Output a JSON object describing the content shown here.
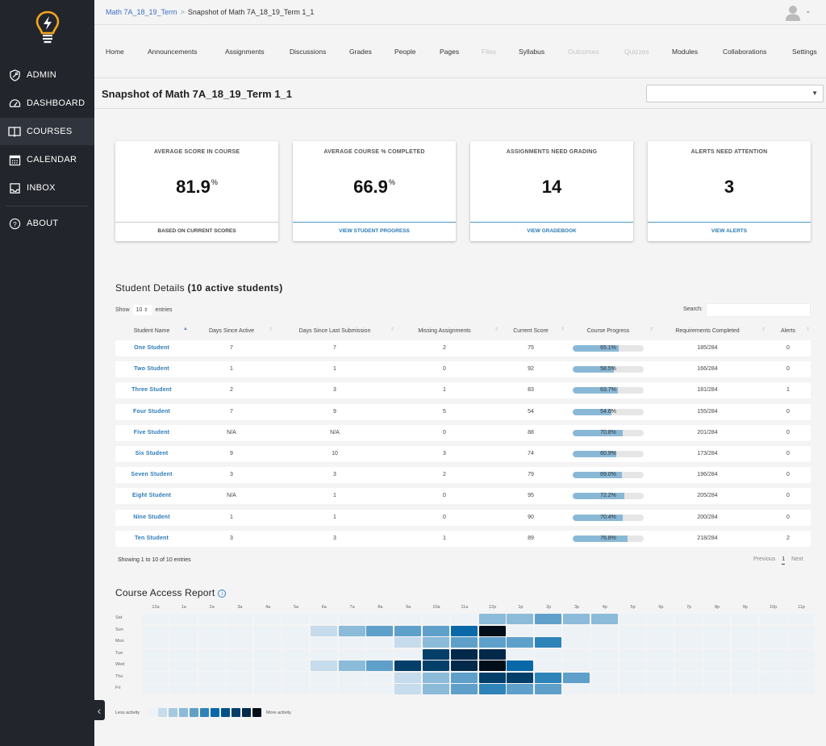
{
  "sidebar": {
    "logo": "lightbulb-logo",
    "items": [
      {
        "label": "ADMIN",
        "icon": "shield-wrench-icon",
        "active": false
      },
      {
        "label": "DASHBOARD",
        "icon": "speedometer-icon",
        "active": false
      },
      {
        "label": "COURSES",
        "icon": "book-icon",
        "active": true
      },
      {
        "label": "CALENDAR",
        "icon": "calendar-icon",
        "active": false
      },
      {
        "label": "INBOX",
        "icon": "inbox-icon",
        "active": false
      },
      {
        "label": "ABOUT",
        "icon": "question-circle-icon",
        "active": false
      }
    ],
    "collapse_icon": "chevron-left-icon"
  },
  "header": {
    "breadcrumb": {
      "parent": "Math 7A_18_19_Term",
      "separator": ">",
      "current": "Snapshot of Math 7A_18_19_Term 1_1"
    },
    "user_menu_icon": "chevron-down-icon"
  },
  "course_nav": [
    {
      "label": "Home",
      "enabled": true
    },
    {
      "label": "Announcements",
      "enabled": true
    },
    {
      "label": "Assignments",
      "enabled": true
    },
    {
      "label": "Discussions",
      "enabled": true
    },
    {
      "label": "Grades",
      "enabled": true
    },
    {
      "label": "People",
      "enabled": true
    },
    {
      "label": "Pages",
      "enabled": true
    },
    {
      "label": "Files",
      "enabled": false
    },
    {
      "label": "Syllabus",
      "enabled": true
    },
    {
      "label": "Outcomes",
      "enabled": false
    },
    {
      "label": "Quizzes",
      "enabled": false
    },
    {
      "label": "Modules",
      "enabled": true
    },
    {
      "label": "Collaborations",
      "enabled": true
    },
    {
      "label": "Settings",
      "enabled": true
    }
  ],
  "page": {
    "title": "Snapshot of Math 7A_18_19_Term 1_1",
    "section_select_value": ""
  },
  "cards": [
    {
      "title": "AVERAGE SCORE IN COURSE",
      "value": "81.9",
      "unit": "%",
      "footer": "BASED ON CURRENT SCORES",
      "footer_link": false
    },
    {
      "title": "AVERAGE COURSE % COMPLETED",
      "value": "66.9",
      "unit": "%",
      "footer": "VIEW STUDENT PROGRESS",
      "footer_link": true
    },
    {
      "title": "ASSIGNMENTS NEED GRADING",
      "value": "14",
      "unit": "",
      "footer": "VIEW GRADEBOOK",
      "footer_link": true
    },
    {
      "title": "ALERTS NEED ATTENTION",
      "value": "3",
      "unit": "",
      "footer": "VIEW ALERTS",
      "footer_link": true
    }
  ],
  "student_details": {
    "title": "Student Details",
    "count_label": "(10 active students)",
    "show_label": "Show",
    "entries_value": "10",
    "entries_label": "entries",
    "search_label": "Search:",
    "search_value": "",
    "columns": [
      "Student Name",
      "Days Since Active",
      "Days Since Last Submission",
      "Missing Assignments",
      "Current Score",
      "Course Progress",
      "Requirements Completed",
      "Alerts"
    ],
    "rows": [
      {
        "name": "One Student",
        "days_active": "7",
        "days_submission": "7",
        "missing": "2",
        "score": "75",
        "progress": 65.1,
        "progress_label": "65.1%",
        "requirements": "185/284",
        "alerts": "0"
      },
      {
        "name": "Two Student",
        "days_active": "1",
        "days_submission": "1",
        "missing": "0",
        "score": "92",
        "progress": 58.5,
        "progress_label": "58.5%",
        "requirements": "166/284",
        "alerts": "0"
      },
      {
        "name": "Three Student",
        "days_active": "2",
        "days_submission": "3",
        "missing": "1",
        "score": "83",
        "progress": 63.7,
        "progress_label": "63.7%",
        "requirements": "181/284",
        "alerts": "1"
      },
      {
        "name": "Four Student",
        "days_active": "7",
        "days_submission": "9",
        "missing": "5",
        "score": "54",
        "progress": 54.6,
        "progress_label": "54.6%",
        "requirements": "155/284",
        "alerts": "0"
      },
      {
        "name": "Five Student",
        "days_active": "N/A",
        "days_submission": "N/A",
        "missing": "0",
        "score": "88",
        "progress": 70.8,
        "progress_label": "70.8%",
        "requirements": "201/284",
        "alerts": "0"
      },
      {
        "name": "Six Student",
        "days_active": "9",
        "days_submission": "10",
        "missing": "3",
        "score": "74",
        "progress": 60.9,
        "progress_label": "60.9%",
        "requirements": "173/284",
        "alerts": "0"
      },
      {
        "name": "Seven Student",
        "days_active": "3",
        "days_submission": "3",
        "missing": "2",
        "score": "79",
        "progress": 69.0,
        "progress_label": "69.0%",
        "requirements": "196/284",
        "alerts": "0"
      },
      {
        "name": "Eight Student",
        "days_active": "N/A",
        "days_submission": "1",
        "missing": "0",
        "score": "95",
        "progress": 72.2,
        "progress_label": "72.2%",
        "requirements": "205/284",
        "alerts": "0"
      },
      {
        "name": "Nine Student",
        "days_active": "1",
        "days_submission": "1",
        "missing": "0",
        "score": "90",
        "progress": 70.4,
        "progress_label": "70.4%",
        "requirements": "200/284",
        "alerts": "0"
      },
      {
        "name": "Ten Student",
        "days_active": "3",
        "days_submission": "3",
        "missing": "1",
        "score": "89",
        "progress": 76.8,
        "progress_label": "76.8%",
        "requirements": "218/284",
        "alerts": "2"
      }
    ],
    "showing_text": "Showing 1 to 10 of 10 entries",
    "pager": {
      "previous": "Previous",
      "current": "1",
      "next": "Next"
    }
  },
  "access_report": {
    "title": "Course Access Report",
    "info_icon": "info-circle-icon",
    "hours": [
      "12a",
      "1a",
      "2a",
      "3a",
      "4a",
      "5a",
      "6a",
      "7a",
      "8a",
      "9a",
      "10a",
      "11a",
      "12p",
      "1p",
      "2p",
      "3p",
      "4p",
      "5p",
      "6p",
      "7p",
      "8p",
      "9p",
      "10p",
      "11p"
    ],
    "days": [
      "Sat",
      "Sun",
      "Mon",
      "Tue",
      "Wed",
      "Thu",
      "Fri"
    ],
    "levels": [
      [
        0,
        0,
        0,
        0,
        0,
        0,
        0,
        0,
        0,
        0,
        0,
        0,
        3,
        3,
        4,
        3,
        3,
        0,
        0,
        0,
        0,
        0,
        0,
        0
      ],
      [
        0,
        0,
        0,
        0,
        0,
        0,
        1,
        3,
        4,
        4,
        4,
        6,
        10,
        0,
        0,
        0,
        0,
        0,
        0,
        0,
        0,
        0,
        0,
        0
      ],
      [
        0,
        0,
        0,
        0,
        0,
        0,
        0,
        0,
        0,
        1,
        3,
        4,
        4,
        4,
        5,
        0,
        0,
        0,
        0,
        0,
        0,
        0,
        0,
        0
      ],
      [
        0,
        0,
        0,
        0,
        0,
        0,
        0,
        0,
        0,
        0,
        8,
        9,
        9,
        0,
        0,
        0,
        0,
        0,
        0,
        0,
        0,
        0,
        0,
        0
      ],
      [
        0,
        0,
        0,
        0,
        0,
        0,
        1,
        3,
        4,
        8,
        8,
        9,
        10,
        6,
        0,
        0,
        0,
        0,
        0,
        0,
        0,
        0,
        0,
        0
      ],
      [
        0,
        0,
        0,
        0,
        0,
        0,
        0,
        0,
        0,
        1,
        3,
        4,
        8,
        8,
        5,
        4,
        0,
        0,
        0,
        0,
        0,
        0,
        0,
        0
      ],
      [
        0,
        0,
        0,
        0,
        0,
        0,
        0,
        0,
        0,
        1,
        3,
        4,
        5,
        4,
        4,
        0,
        0,
        0,
        0,
        0,
        0,
        0,
        0,
        0
      ]
    ],
    "palette": [
      "#edf2f7",
      "#c6dbeb",
      "#a6c8e0",
      "#8bbbd8",
      "#5fa0ca",
      "#2e84b8",
      "#0868a8",
      "#04508a",
      "#043f6a",
      "#03294a",
      "#010d18"
    ],
    "legend_less": "Less activity",
    "legend_more": "More activity"
  }
}
